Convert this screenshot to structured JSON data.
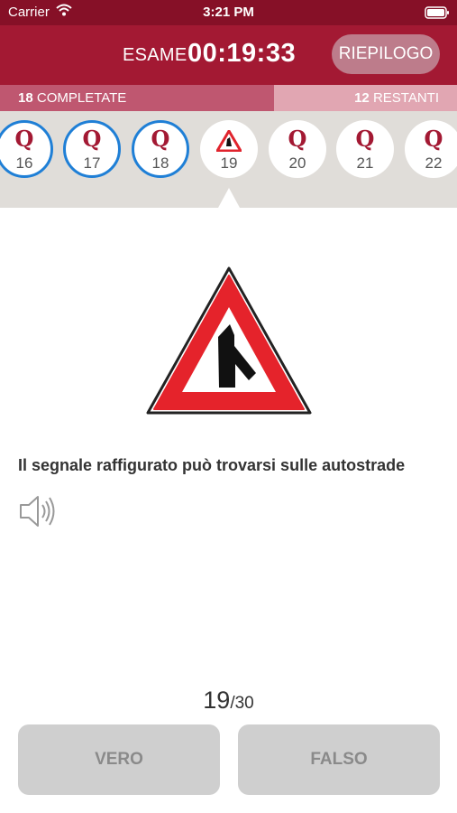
{
  "status_bar": {
    "carrier": "Carrier",
    "time": "3:21 PM"
  },
  "header": {
    "exam_label": "ESAME",
    "timer": "00:19:33",
    "summary_button": "RIEPILOGO"
  },
  "progress": {
    "completed_count": "18",
    "completed_label": "COMPLETATE",
    "remaining_count": "12",
    "remaining_label": "RESTANTI",
    "fraction": 0.6
  },
  "questions": [
    {
      "letter": "Q",
      "number": "16",
      "state": "answered"
    },
    {
      "letter": "Q",
      "number": "17",
      "state": "answered"
    },
    {
      "letter": "Q",
      "number": "18",
      "state": "answered"
    },
    {
      "letter": "",
      "number": "19",
      "state": "current",
      "icon": "road-sign-icon"
    },
    {
      "letter": "Q",
      "number": "20",
      "state": "unanswered"
    },
    {
      "letter": "Q",
      "number": "21",
      "state": "unanswered"
    },
    {
      "letter": "Q",
      "number": "22",
      "state": "unanswered"
    }
  ],
  "question": {
    "text": "Il segnale raffigurato può trovarsi sulle autostrade",
    "sign_icon": "merging-traffic-warning-sign",
    "audio_icon": "speaker-icon"
  },
  "counter": {
    "current": "19",
    "total": "/30"
  },
  "answers": {
    "true_label": "VERO",
    "false_label": "FALSO"
  },
  "colors": {
    "brand": "#a31933",
    "answered_ring": "#1f7fd6",
    "button_gray": "#cfcfcf"
  }
}
